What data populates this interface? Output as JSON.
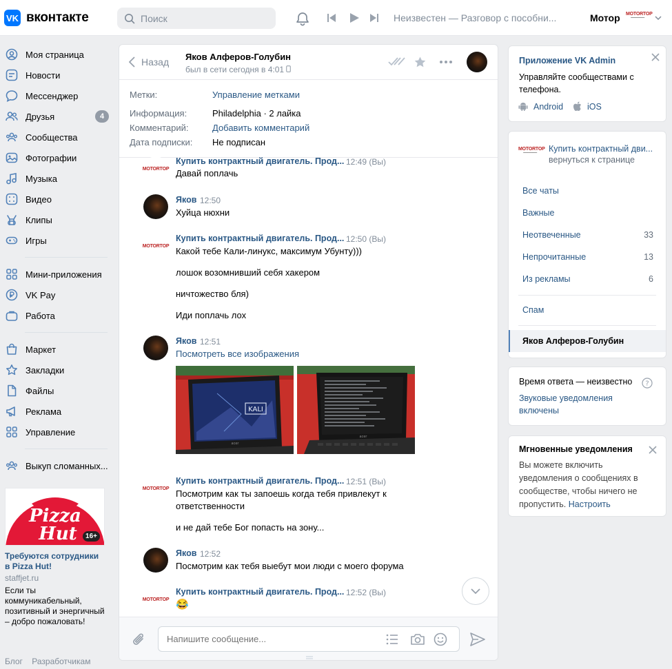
{
  "header": {
    "logo_text": "вконтакте",
    "logo_mark": "VK",
    "search_placeholder": "Поиск",
    "track": "Неизвестен — Разговор с пособни...",
    "profile_name": "Мотор",
    "profile_logo": "MOTORTOP"
  },
  "nav": {
    "items": [
      {
        "label": "Моя страница",
        "icon": "user-icon"
      },
      {
        "label": "Новости",
        "icon": "news-icon"
      },
      {
        "label": "Мессенджер",
        "icon": "chat-icon"
      },
      {
        "label": "Друзья",
        "icon": "friends-icon",
        "badge": "4"
      },
      {
        "label": "Сообщества",
        "icon": "groups-icon"
      },
      {
        "label": "Фотографии",
        "icon": "photo-icon"
      },
      {
        "label": "Музыка",
        "icon": "music-icon"
      },
      {
        "label": "Видео",
        "icon": "video-icon"
      },
      {
        "label": "Клипы",
        "icon": "clips-icon"
      },
      {
        "label": "Игры",
        "icon": "games-icon"
      },
      {
        "label": "Мини-приложения",
        "icon": "apps-icon"
      },
      {
        "label": "VK Pay",
        "icon": "vkpay-icon"
      },
      {
        "label": "Работа",
        "icon": "work-icon"
      },
      {
        "label": "Маркет",
        "icon": "market-icon"
      },
      {
        "label": "Закладки",
        "icon": "bookmark-icon"
      },
      {
        "label": "Файлы",
        "icon": "file-icon"
      },
      {
        "label": "Реклама",
        "icon": "ads-icon"
      },
      {
        "label": "Управление",
        "icon": "manage-icon"
      },
      {
        "label": "Выкуп сломанных...",
        "icon": "group-icon"
      }
    ]
  },
  "ad": {
    "title": "Требуются сотрудники в Pizza Hut!",
    "domain": "staffjet.ru",
    "text": "Если ты коммуникабельный, позитивный и энергичный – добро пожаловать!",
    "age": "16+",
    "brand_line1": "Pizza",
    "brand_line2": "Hut"
  },
  "footer": {
    "links": [
      "Блог",
      "Разработчикам"
    ]
  },
  "chat": {
    "back_label": "Назад",
    "peer_name": "Яков Алферов-Голубин",
    "peer_status": "был в сети сегодня в 4:01",
    "meta": [
      {
        "key": "Метки:",
        "value": "Управление метками",
        "link": true
      },
      {
        "key": "Информация:",
        "value": "Philadelphia · 2 лайка",
        "link": false
      },
      {
        "key": "Комментарий:",
        "value": "Добавить комментарий",
        "link": true
      },
      {
        "key": "Дата подписки:",
        "value": "Не подписан",
        "link": false
      }
    ],
    "messages": [
      {
        "author": "Купить контрактный двигатель. Прод...",
        "time": "12:49 (Вы)",
        "lines": [
          "Давай поплачь"
        ]
      },
      {
        "author": "Яков",
        "time": "12:50",
        "lines": [
          "Хуйца нюхни"
        ]
      },
      {
        "author": "Купить контрактный двигатель. Прод...",
        "time": "12:50 (Вы)",
        "lines": [
          "Какой тебе Кали-линукс, максимум Убунту)))",
          "лошок возомнивший себя хакером",
          "ничтожество бля)",
          "Иди поплачь лох"
        ]
      },
      {
        "author": "Яков",
        "time": "12:51",
        "lines": [
          "Посмотреть все изображения"
        ],
        "photos": [
          "KALI"
        ]
      },
      {
        "author": "Купить контрактный двигатель. Прод...",
        "time": "12:51 (Вы)",
        "lines": [
          "Посмотрим как ты запоешь когда тебя привлекут к",
          "ответственности",
          "и не дай тебе Бог попасть на зону..."
        ]
      },
      {
        "author": "Яков",
        "time": "12:52",
        "lines": [
          "Посмотрим как тебя выебут мои люди с моего форума"
        ]
      },
      {
        "author": "Купить контрактный двигатель. Прод...",
        "time": "12:52 (Вы)",
        "lines": [
          "😂"
        ]
      }
    ],
    "composer_placeholder": "Напишите сообщение..."
  },
  "right": {
    "vkadmin": {
      "title": "Приложение VK Admin",
      "desc": "Управляйте сообществами с телефона.",
      "android": "Android",
      "ios": "iOS"
    },
    "group": {
      "name": "Купить контрактный дви...",
      "back": "вернуться к странице"
    },
    "folders": [
      {
        "label": "Все чаты",
        "count": ""
      },
      {
        "label": "Важные",
        "count": ""
      },
      {
        "label": "Неотвеченные",
        "count": "33"
      },
      {
        "label": "Непрочитанные",
        "count": "13"
      },
      {
        "label": "Из рекламы",
        "count": "6"
      },
      {
        "label": "Спам",
        "count": ""
      }
    ],
    "active_chat": "Яков Алферов-Голубин",
    "response": {
      "time": "Время ответа — неизвестно",
      "sound": "Звуковые уведомления включены"
    },
    "instant": {
      "title": "Мгновенные уведомления",
      "desc": "Вы можете включить уведомления о сообщениях в сообществе, чтобы ничего не пропустить.",
      "link": "Настроить"
    }
  },
  "colors": {
    "accent": "#2a5885",
    "brand": "#0077ff",
    "background": "#edeef0",
    "muted": "#818c99"
  }
}
